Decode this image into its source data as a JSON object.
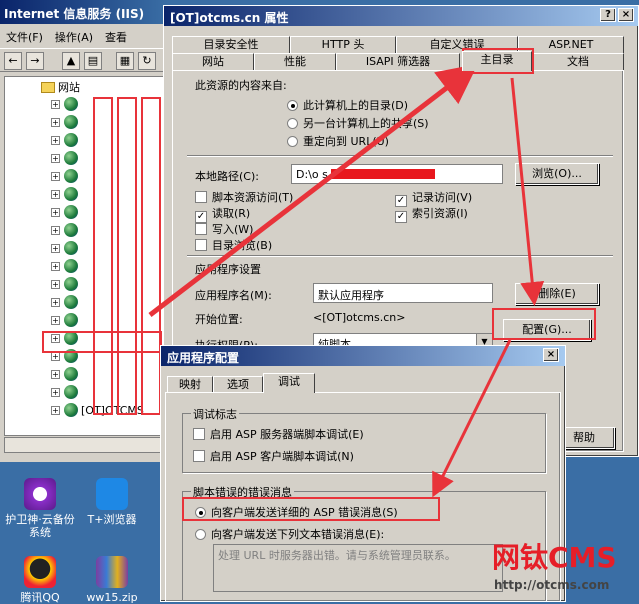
{
  "iis": {
    "title": "Internet 信息服务 (IIS)",
    "menu": [
      "文件(F)",
      "操作(A)",
      "查看"
    ],
    "tree_root": "网站",
    "site_row_label": "[OT]OTCMS"
  },
  "desktop": {
    "icons": [
      {
        "label": "护卫神·云备份系统",
        "icon": "cloud-backup-icon"
      },
      {
        "label": "T+浏览器",
        "icon": "browser-icon"
      },
      {
        "label": "腾讯QQ",
        "icon": "qq-icon"
      },
      {
        "label": "ww15.zip",
        "icon": "winrar-archive-icon"
      }
    ]
  },
  "props": {
    "title": "[OT]otcms.cn 属性",
    "help_btn": "?",
    "close_btn": "×",
    "tabs_back": [
      "目录安全性",
      "HTTP 头",
      "自定义错误",
      "ASP.NET"
    ],
    "tabs_front": [
      "网站",
      "性能",
      "ISAPI 筛选器",
      "主目录",
      "文档"
    ],
    "source_label": "此资源的内容来自:",
    "source_options": [
      "此计算机上的目录(D)",
      "另一台计算机上的共享(S)",
      "重定向到 URL(U)"
    ],
    "local_path_label": "本地路径(C):",
    "local_path_value": "D:\\o                      s.cn",
    "browse_btn": "浏览(O)...",
    "perms_left": [
      {
        "label": "脚本资源访问(T)",
        "checked": false
      },
      {
        "label": "读取(R)",
        "checked": true
      },
      {
        "label": "写入(W)",
        "checked": false
      },
      {
        "label": "目录浏览(B)",
        "checked": false
      }
    ],
    "perms_right": [
      {
        "label": "记录访问(V)",
        "checked": true
      },
      {
        "label": "索引资源(I)",
        "checked": true
      }
    ],
    "app_settings_label": "应用程序设置",
    "app_name_label": "应用程序名(M):",
    "app_name_value": "默认应用程序",
    "remove_btn": "删除(E)",
    "start_pos_label": "开始位置:",
    "start_pos_value": "<[OT]otcms.cn>",
    "config_btn": "配置(G)...",
    "exec_perm_label": "执行权限(P):",
    "exec_perm_value": "纯脚本",
    "help_button": "帮助"
  },
  "appcfg": {
    "title": "应用程序配置",
    "close_btn": "×",
    "tabs": [
      "映射",
      "选项",
      "调试"
    ],
    "debug_group": "调试标志",
    "debug_options": [
      {
        "label": "启用 ASP 服务器端脚本调试(E)",
        "checked": false
      },
      {
        "label": "启用 ASP 客户端脚本调试(N)",
        "checked": false
      }
    ],
    "error_group": "脚本错误的错误消息",
    "error_options": [
      {
        "label": "向客户端发送详细的 ASP 错误消息(S)",
        "selected": true
      },
      {
        "label": "向客户端发送下列文本错误消息(E):",
        "selected": false
      }
    ],
    "error_text": "处理 URL 时服务器出错。请与系统管理员联系。"
  },
  "watermark": {
    "brand": "网钛CMS",
    "url": "http://otcms.com"
  },
  "colors": {
    "highlight": "#e8333a",
    "titlebar": "#0a246a",
    "brand_red": "#e61e28"
  }
}
